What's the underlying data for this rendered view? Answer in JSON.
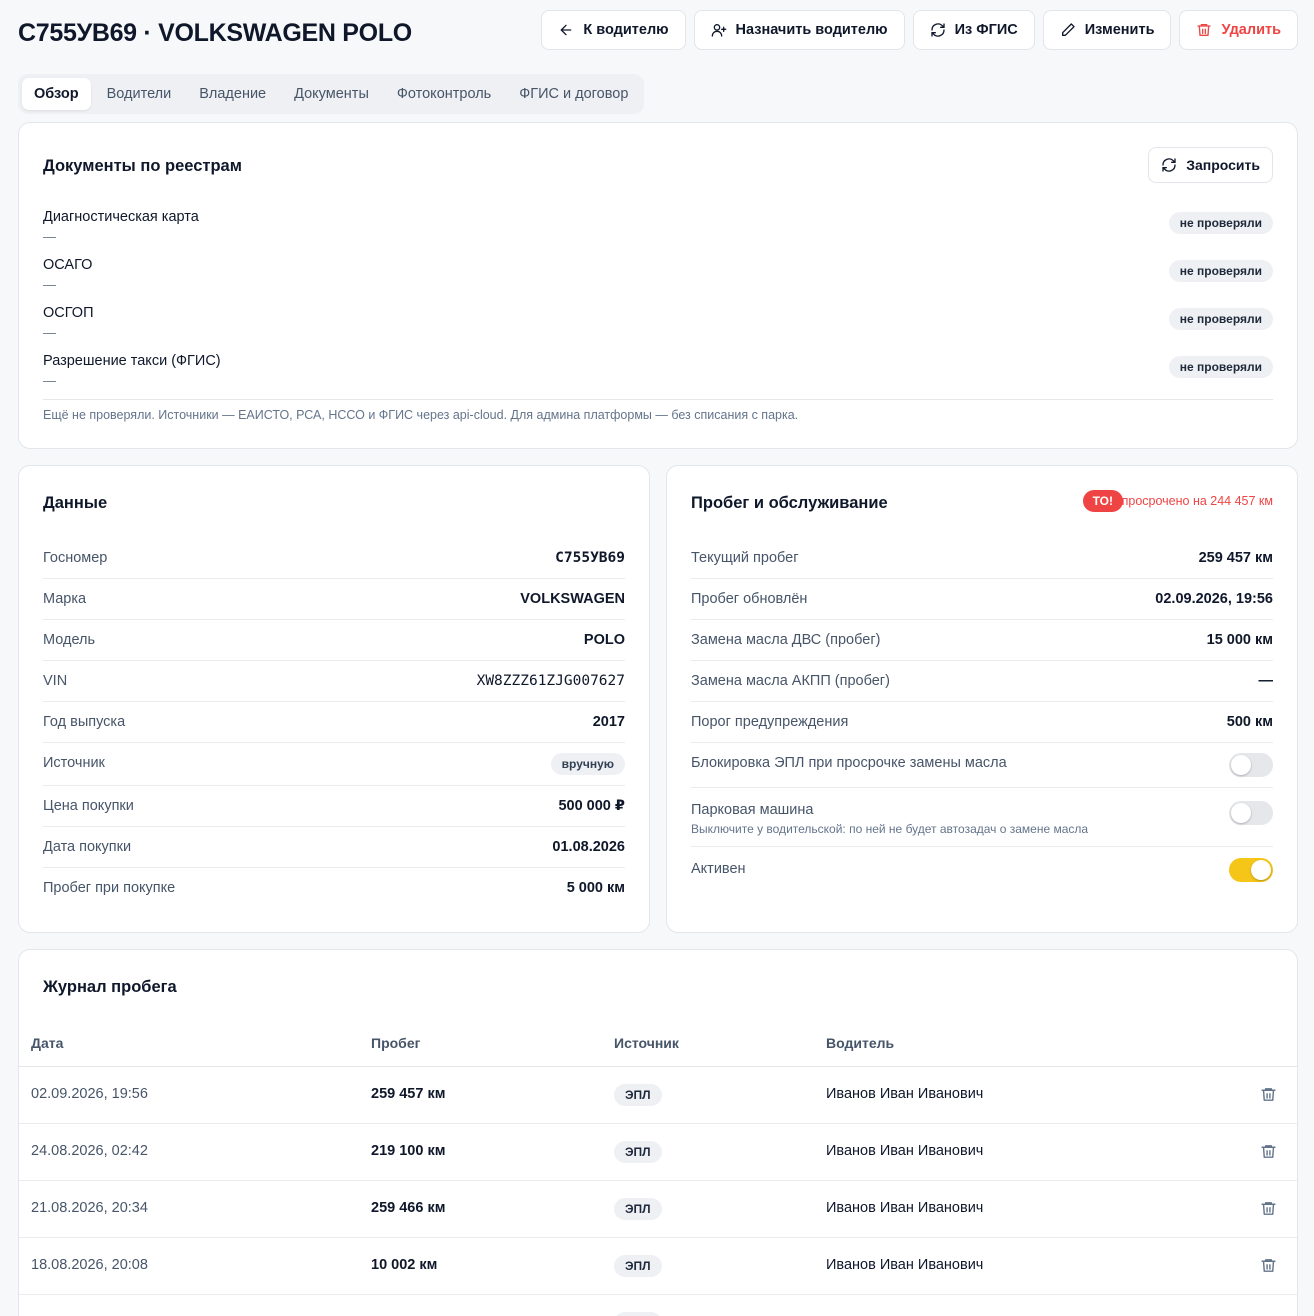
{
  "header": {
    "title": "С755УВ69 · VOLKSWAGEN POLO",
    "actions": {
      "back": "К водителю",
      "assign": "Назначить водителю",
      "fgis": "Из ФГИС",
      "edit": "Изменить",
      "delete": "Удалить"
    }
  },
  "tabs": [
    "Обзор",
    "Водители",
    "Владение",
    "Документы",
    "Фотоконтроль",
    "ФГИС и договор"
  ],
  "active_tab": "Обзор",
  "registries": {
    "title": "Документы по реестрам",
    "request_label": "Запросить",
    "items": [
      {
        "name": "Диагностическая карта",
        "value": "—",
        "status": "не проверяли"
      },
      {
        "name": "ОСАГО",
        "value": "—",
        "status": "не проверяли"
      },
      {
        "name": "ОСГОП",
        "value": "—",
        "status": "не проверяли"
      },
      {
        "name": "Разрешение такси (ФГИС)",
        "value": "—",
        "status": "не проверяли"
      }
    ],
    "note": "Ещё не проверяли. Источники — ЕАИСТО, РСА, НССО и ФГИС через api-cloud. Для админа платформы — без списания с парка."
  },
  "data_card": {
    "title": "Данные",
    "rows": [
      {
        "label": "Госномер",
        "value": "С755УВ69"
      },
      {
        "label": "Марка",
        "value": "VOLKSWAGEN"
      },
      {
        "label": "Модель",
        "value": "POLO"
      },
      {
        "label": "VIN",
        "value": "XW8ZZZ61ZJG007627"
      },
      {
        "label": "Год выпуска",
        "value": "2017"
      },
      {
        "label": "Источник",
        "value": "вручную"
      },
      {
        "label": "Цена покупки",
        "value": "500 000 ₽"
      },
      {
        "label": "Дата покупки",
        "value": "01.08.2026"
      },
      {
        "label": "Пробег при покупке",
        "value": "5 000 км"
      }
    ]
  },
  "mileage_card": {
    "title": "Пробег и обслуживание",
    "badge": "ТО!",
    "overdue_text": "просрочено на 244 457 км",
    "rows": [
      {
        "label": "Текущий пробег",
        "value": "259 457 км"
      },
      {
        "label": "Пробег обновлён",
        "value": "02.09.2026, 19:56"
      },
      {
        "label": "Замена масла ДВС (пробег)",
        "value": "15 000 км"
      },
      {
        "label": "Замена масла АКПП (пробег)",
        "value": "—"
      },
      {
        "label": "Порог предупреждения",
        "value": "500 км"
      }
    ],
    "toggles": [
      {
        "label": "Блокировка ЭПЛ при просрочке замены масла",
        "hint": "",
        "on": false
      },
      {
        "label": "Парковая машина",
        "hint": "Выключите у водительской: по ней не будет автозадач о замене масла",
        "on": false
      },
      {
        "label": "Активен",
        "hint": "",
        "on": true
      }
    ]
  },
  "log": {
    "title": "Журнал пробега",
    "columns": [
      "Дата",
      "Пробег",
      "Источник",
      "Водитель"
    ],
    "rows": [
      {
        "date": "02.09.2026, 19:56",
        "km": "259 457 км",
        "source": "ЭПЛ",
        "driver": "Иванов Иван Иванович"
      },
      {
        "date": "24.08.2026, 02:42",
        "km": "219 100 км",
        "source": "ЭПЛ",
        "driver": "Иванов Иван Иванович"
      },
      {
        "date": "21.08.2026, 20:34",
        "km": "259 466 км",
        "source": "ЭПЛ",
        "driver": "Иванов Иван Иванович"
      },
      {
        "date": "18.08.2026, 20:08",
        "km": "10 002 км",
        "source": "ЭПЛ",
        "driver": "Иванов Иван Иванович"
      }
    ]
  },
  "colors": {
    "accent": "#f5c518",
    "danger": "#ef4444",
    "background": "#f7f8fa"
  }
}
